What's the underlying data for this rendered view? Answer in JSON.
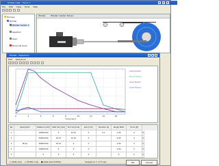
{
  "main_window": {
    "title": "Simple Logic - Servo 1",
    "menu": [
      "File",
      "Edit",
      "View",
      "Tools",
      "Help"
    ]
  },
  "tree": {
    "items": [
      {
        "label": "Process"
      },
      {
        "label": "Winder"
      },
      {
        "label": "Winder Center 3"
      },
      {
        "label": "Gearbox"
      },
      {
        "label": "Gear"
      },
      {
        "label": "Drive CR drive"
      }
    ]
  },
  "diagram": {
    "tab_label": "Winder",
    "title": "Winder: Center Driven"
  },
  "sequence_window": {
    "title": "Winder - Sequence",
    "menu": [
      "Edit",
      "Sequence"
    ],
    "x_axis_label": "Time [sec]"
  },
  "legend": {
    "items": [
      {
        "label": "Load Inertia",
        "color": "#7b2fa3"
      },
      {
        "label": "Drive Torque",
        "color": "#2ea7a0"
      },
      {
        "label": "Load Speed",
        "color": "#9a2f7a"
      },
      {
        "label": "Load Torque",
        "color": "#1f6fcf"
      }
    ]
  },
  "table": {
    "headers": [
      "No",
      "Description",
      "Distance [mm]",
      "Start Vel [m/s]",
      "End Vel [m/s]",
      "Jerk [m/s³]",
      "Duration [s]",
      "Rough Start",
      "Force [N]"
    ],
    "rows": [
      {
        "no": "1",
        "desc": "",
        "cells": [
          "10000.000",
          "0",
          "10.47",
          "0",
          "0.1",
          "1.00",
          "0",
          "0"
        ]
      },
      {
        "no": "2",
        "desc": "",
        "cells": [
          "50000.000",
          "10.47",
          "10.47",
          "0",
          "",
          "5.00",
          "0",
          "0"
        ]
      },
      {
        "no": "3",
        "desc": "Move",
        "cells": [
          "30000.000",
          "10.47",
          "0",
          "0",
          "",
          "2.00",
          "0",
          "0"
        ]
      },
      {
        "no": "4",
        "desc": "",
        "cells": [
          "10000.000",
          "0",
          "0",
          "0",
          "",
          "3.00",
          "0",
          "0"
        ]
      },
      {
        "no": "5",
        "desc": "",
        "cells": [
          "0",
          "0",
          "0",
          "0",
          "",
          "0",
          "0",
          "0"
        ]
      }
    ]
  },
  "bottom": {
    "option1": "Data only",
    "option2": "Profile only",
    "option3": "Data and Profiles",
    "status": "Sequence = 17.5 sec",
    "ok": "OK",
    "cancel": "Cancel"
  },
  "chart_data": {
    "type": "line",
    "x_label": "Time [sec]",
    "x_ticks": [
      "0",
      "2",
      "4",
      "6",
      "8",
      "10",
      "12",
      "14",
      "16"
    ],
    "xlim": [
      0,
      17.5
    ],
    "series": [
      {
        "name": "Load Inertia",
        "color": "#7b2fa3",
        "x": [
          0,
          2,
          3,
          4,
          6,
          8,
          10,
          12,
          14,
          16,
          17.5
        ],
        "y": [
          0.2,
          1.0,
          0.95,
          0.8,
          0.6,
          0.45,
          0.3,
          0.2,
          0.12,
          0.05,
          0.05
        ]
      },
      {
        "name": "Drive Torque",
        "color": "#2ea7a0",
        "x": [
          0,
          1,
          2,
          3,
          10,
          12,
          14,
          17.5
        ],
        "y": [
          0.05,
          0.45,
          0.92,
          0.92,
          0.92,
          0.92,
          0.2,
          0.05
        ]
      },
      {
        "name": "Load Speed",
        "color": "#9a2f7a",
        "x": [
          0,
          2,
          3,
          12,
          16,
          17.5
        ],
        "y": [
          0.08,
          0.12,
          0.12,
          0.12,
          0.12,
          0.1
        ]
      },
      {
        "name": "Load Torque",
        "color": "#1f6fcf",
        "x": [
          0,
          1,
          2,
          3,
          4,
          17.5
        ],
        "y": [
          0.02,
          0.12,
          0.15,
          0.1,
          0.05,
          0.05
        ]
      }
    ],
    "grid": true,
    "legend": "right"
  }
}
